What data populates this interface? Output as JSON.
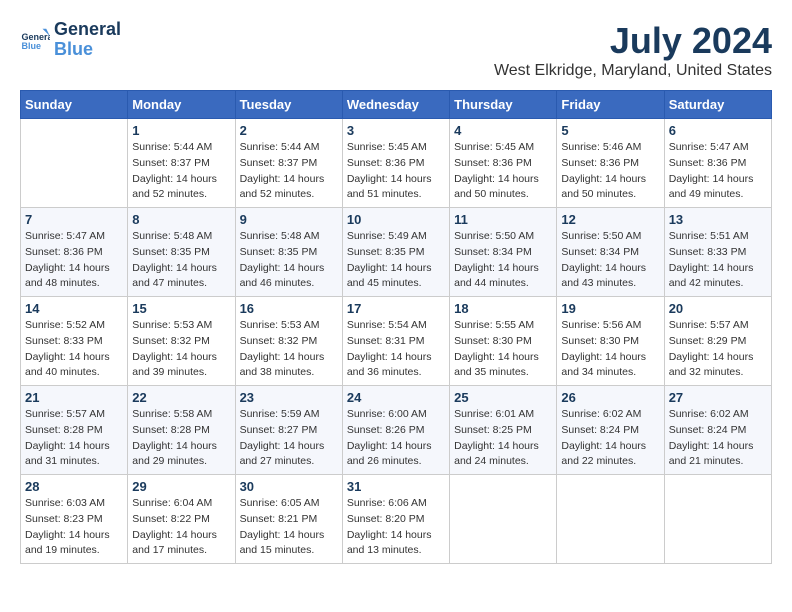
{
  "header": {
    "logo_line1": "General",
    "logo_line2": "Blue",
    "month_year": "July 2024",
    "location": "West Elkridge, Maryland, United States"
  },
  "days_of_week": [
    "Sunday",
    "Monday",
    "Tuesday",
    "Wednesday",
    "Thursday",
    "Friday",
    "Saturday"
  ],
  "weeks": [
    [
      {
        "day": "",
        "info": ""
      },
      {
        "day": "1",
        "info": "Sunrise: 5:44 AM\nSunset: 8:37 PM\nDaylight: 14 hours\nand 52 minutes."
      },
      {
        "day": "2",
        "info": "Sunrise: 5:44 AM\nSunset: 8:37 PM\nDaylight: 14 hours\nand 52 minutes."
      },
      {
        "day": "3",
        "info": "Sunrise: 5:45 AM\nSunset: 8:36 PM\nDaylight: 14 hours\nand 51 minutes."
      },
      {
        "day": "4",
        "info": "Sunrise: 5:45 AM\nSunset: 8:36 PM\nDaylight: 14 hours\nand 50 minutes."
      },
      {
        "day": "5",
        "info": "Sunrise: 5:46 AM\nSunset: 8:36 PM\nDaylight: 14 hours\nand 50 minutes."
      },
      {
        "day": "6",
        "info": "Sunrise: 5:47 AM\nSunset: 8:36 PM\nDaylight: 14 hours\nand 49 minutes."
      }
    ],
    [
      {
        "day": "7",
        "info": "Sunrise: 5:47 AM\nSunset: 8:36 PM\nDaylight: 14 hours\nand 48 minutes."
      },
      {
        "day": "8",
        "info": "Sunrise: 5:48 AM\nSunset: 8:35 PM\nDaylight: 14 hours\nand 47 minutes."
      },
      {
        "day": "9",
        "info": "Sunrise: 5:48 AM\nSunset: 8:35 PM\nDaylight: 14 hours\nand 46 minutes."
      },
      {
        "day": "10",
        "info": "Sunrise: 5:49 AM\nSunset: 8:35 PM\nDaylight: 14 hours\nand 45 minutes."
      },
      {
        "day": "11",
        "info": "Sunrise: 5:50 AM\nSunset: 8:34 PM\nDaylight: 14 hours\nand 44 minutes."
      },
      {
        "day": "12",
        "info": "Sunrise: 5:50 AM\nSunset: 8:34 PM\nDaylight: 14 hours\nand 43 minutes."
      },
      {
        "day": "13",
        "info": "Sunrise: 5:51 AM\nSunset: 8:33 PM\nDaylight: 14 hours\nand 42 minutes."
      }
    ],
    [
      {
        "day": "14",
        "info": "Sunrise: 5:52 AM\nSunset: 8:33 PM\nDaylight: 14 hours\nand 40 minutes."
      },
      {
        "day": "15",
        "info": "Sunrise: 5:53 AM\nSunset: 8:32 PM\nDaylight: 14 hours\nand 39 minutes."
      },
      {
        "day": "16",
        "info": "Sunrise: 5:53 AM\nSunset: 8:32 PM\nDaylight: 14 hours\nand 38 minutes."
      },
      {
        "day": "17",
        "info": "Sunrise: 5:54 AM\nSunset: 8:31 PM\nDaylight: 14 hours\nand 36 minutes."
      },
      {
        "day": "18",
        "info": "Sunrise: 5:55 AM\nSunset: 8:30 PM\nDaylight: 14 hours\nand 35 minutes."
      },
      {
        "day": "19",
        "info": "Sunrise: 5:56 AM\nSunset: 8:30 PM\nDaylight: 14 hours\nand 34 minutes."
      },
      {
        "day": "20",
        "info": "Sunrise: 5:57 AM\nSunset: 8:29 PM\nDaylight: 14 hours\nand 32 minutes."
      }
    ],
    [
      {
        "day": "21",
        "info": "Sunrise: 5:57 AM\nSunset: 8:28 PM\nDaylight: 14 hours\nand 31 minutes."
      },
      {
        "day": "22",
        "info": "Sunrise: 5:58 AM\nSunset: 8:28 PM\nDaylight: 14 hours\nand 29 minutes."
      },
      {
        "day": "23",
        "info": "Sunrise: 5:59 AM\nSunset: 8:27 PM\nDaylight: 14 hours\nand 27 minutes."
      },
      {
        "day": "24",
        "info": "Sunrise: 6:00 AM\nSunset: 8:26 PM\nDaylight: 14 hours\nand 26 minutes."
      },
      {
        "day": "25",
        "info": "Sunrise: 6:01 AM\nSunset: 8:25 PM\nDaylight: 14 hours\nand 24 minutes."
      },
      {
        "day": "26",
        "info": "Sunrise: 6:02 AM\nSunset: 8:24 PM\nDaylight: 14 hours\nand 22 minutes."
      },
      {
        "day": "27",
        "info": "Sunrise: 6:02 AM\nSunset: 8:24 PM\nDaylight: 14 hours\nand 21 minutes."
      }
    ],
    [
      {
        "day": "28",
        "info": "Sunrise: 6:03 AM\nSunset: 8:23 PM\nDaylight: 14 hours\nand 19 minutes."
      },
      {
        "day": "29",
        "info": "Sunrise: 6:04 AM\nSunset: 8:22 PM\nDaylight: 14 hours\nand 17 minutes."
      },
      {
        "day": "30",
        "info": "Sunrise: 6:05 AM\nSunset: 8:21 PM\nDaylight: 14 hours\nand 15 minutes."
      },
      {
        "day": "31",
        "info": "Sunrise: 6:06 AM\nSunset: 8:20 PM\nDaylight: 14 hours\nand 13 minutes."
      },
      {
        "day": "",
        "info": ""
      },
      {
        "day": "",
        "info": ""
      },
      {
        "day": "",
        "info": ""
      }
    ]
  ]
}
